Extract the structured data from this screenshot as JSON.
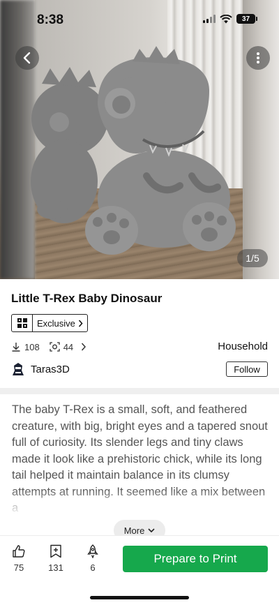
{
  "status_bar": {
    "time": "8:38",
    "battery": "37"
  },
  "gallery": {
    "counter": "1/5"
  },
  "model": {
    "title": "Little T-Rex Baby Dinosaur",
    "badge_label": "Exclusive",
    "downloads": "108",
    "prints": "44",
    "category": "Household"
  },
  "author": {
    "name": "Taras3D",
    "follow_label": "Follow"
  },
  "description": {
    "text": "The baby T-Rex is a small, soft, and feathered creature, with big, bright eyes and a tapered snout full of curiosity. Its slender legs and tiny claws made it look like a prehistoric chick, while its long tail helped it maintain balance in its clumsy attempts at running. It seemed like a mix between a",
    "more_label": "More"
  },
  "actions": {
    "likes": "75",
    "collects": "131",
    "boosts": "6",
    "print_label": "Prepare to Print"
  },
  "colors": {
    "accent": "#16a84c"
  },
  "icons": [
    "back-arrow-icon",
    "more-vertical-icon",
    "download-icon",
    "print-count-icon",
    "chevron-right-icon",
    "thumbs-up-icon",
    "collect-icon",
    "rocket-icon",
    "chevron-down-icon"
  ]
}
